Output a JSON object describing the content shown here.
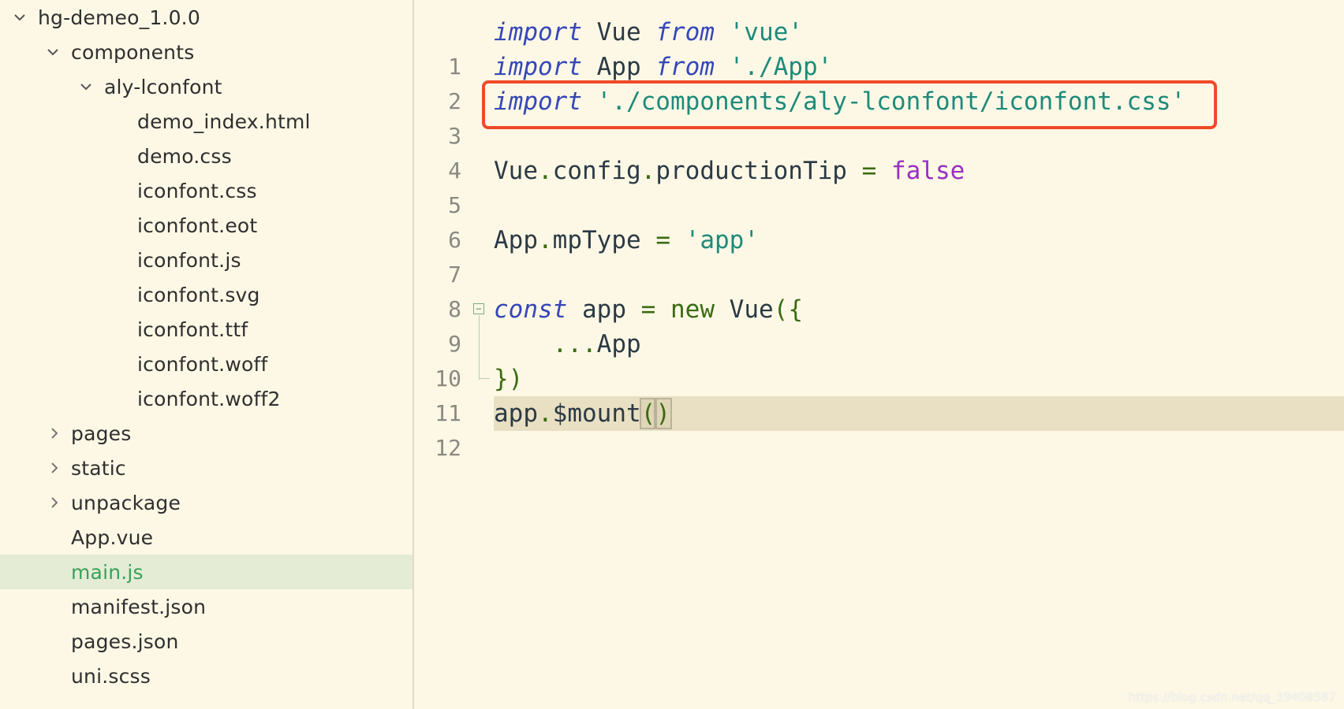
{
  "sidebar": {
    "items": [
      {
        "label": "hg-demeo_1.0.0",
        "chevron": "expanded"
      },
      {
        "label": "components",
        "chevron": "expanded"
      },
      {
        "label": "aly-lconfont",
        "chevron": "expanded"
      },
      {
        "label": "demo_index.html"
      },
      {
        "label": "demo.css"
      },
      {
        "label": "iconfont.css"
      },
      {
        "label": "iconfont.eot"
      },
      {
        "label": "iconfont.js"
      },
      {
        "label": "iconfont.svg"
      },
      {
        "label": "iconfont.ttf"
      },
      {
        "label": "iconfont.woff"
      },
      {
        "label": "iconfont.woff2"
      },
      {
        "label": "pages",
        "chevron": "collapsed"
      },
      {
        "label": "static",
        "chevron": "collapsed"
      },
      {
        "label": "unpackage",
        "chevron": "collapsed"
      },
      {
        "label": "App.vue"
      },
      {
        "label": "main.js",
        "selected": true
      },
      {
        "label": "manifest.json"
      },
      {
        "label": "pages.json"
      },
      {
        "label": "uni.scss"
      }
    ]
  },
  "editor": {
    "line_numbers": [
      "1",
      "2",
      "3",
      "4",
      "5",
      "6",
      "7",
      "8",
      "9",
      "10",
      "11",
      "12"
    ],
    "lines": {
      "l1": {
        "t1": "import",
        "t2": " Vue ",
        "t3": "from",
        "t4": " ",
        "t5": "'vue'"
      },
      "l2": {
        "t1": "import",
        "t2": " App ",
        "t3": "from",
        "t4": " ",
        "t5": "'./App'"
      },
      "l3": {
        "t1": "import",
        "t2": " ",
        "t3": "'./components/aly-lconfont/iconfont.css'"
      },
      "l5": {
        "t1": "Vue",
        "t2": ".",
        "t3": "config",
        "t4": ".",
        "t5": "productionTip ",
        "t6": "=",
        "t7": " ",
        "t8": "false"
      },
      "l7": {
        "t1": "App",
        "t2": ".",
        "t3": "mpType ",
        "t4": "=",
        "t5": " ",
        "t6": "'app'"
      },
      "l9": {
        "t1": "const",
        "t2": " app ",
        "t3": "=",
        "t4": " ",
        "t5": "new",
        "t6": " Vue",
        "t7": "({"
      },
      "l10": {
        "t1": "    ",
        "t2": "...",
        "t3": "App"
      },
      "l11": {
        "t1": "})"
      },
      "l12": {
        "t1": "app",
        "t2": ".",
        "t3": "$mount",
        "t4": "(",
        "t5": ")"
      }
    },
    "current_line": 12,
    "annotation": {
      "color": "#ef4a2a",
      "target_line": 3
    }
  },
  "watermark": "https://blog.csdn.net/qq_39408587",
  "colors": {
    "background": "#fdf8e6",
    "selected_row": "#e4ecd5",
    "selected_text": "#3aa15a",
    "keyword": "#3547b8",
    "string": "#1e8a7a",
    "boolean": "#9a2fc2"
  }
}
